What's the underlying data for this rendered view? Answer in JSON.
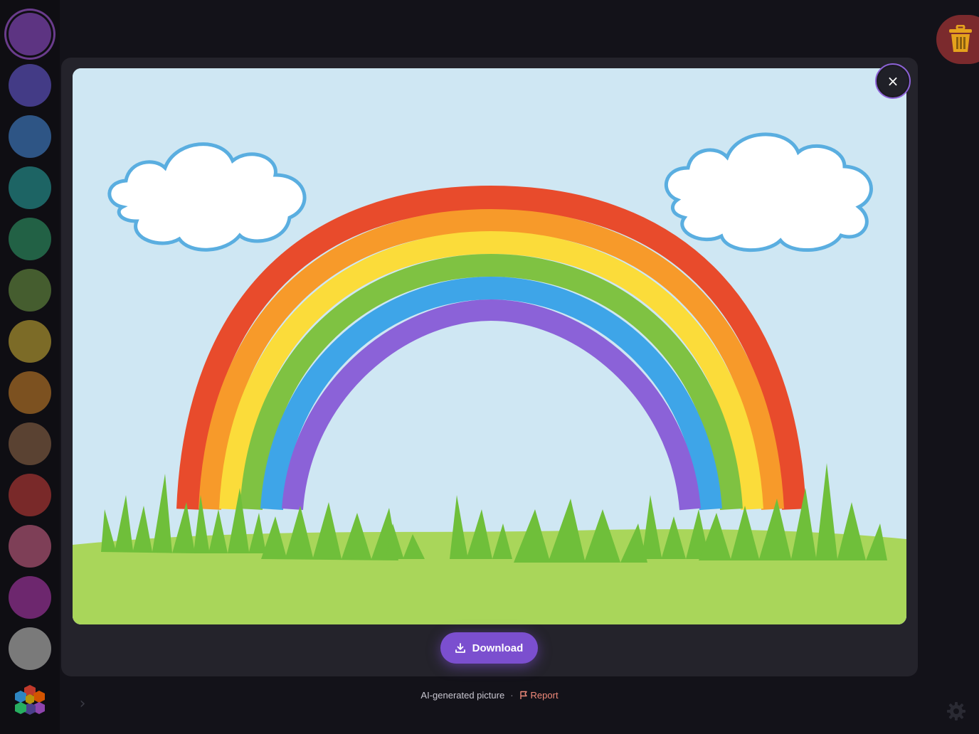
{
  "sidebar": {
    "swatches": [
      {
        "name": "swatch-purple",
        "color": "#5d3482",
        "selected": true
      },
      {
        "name": "swatch-indigo",
        "color": "#433b86"
      },
      {
        "name": "swatch-blue",
        "color": "#2e5585"
      },
      {
        "name": "swatch-teal",
        "color": "#1d6464"
      },
      {
        "name": "swatch-green",
        "color": "#226145"
      },
      {
        "name": "swatch-olive",
        "color": "#455d2f"
      },
      {
        "name": "swatch-mustard",
        "color": "#7c6b27"
      },
      {
        "name": "swatch-orange",
        "color": "#7c5120"
      },
      {
        "name": "swatch-brown",
        "color": "#5a4232"
      },
      {
        "name": "swatch-red",
        "color": "#792929"
      },
      {
        "name": "swatch-pink",
        "color": "#7e3f57"
      },
      {
        "name": "swatch-magenta",
        "color": "#6d276e"
      },
      {
        "name": "swatch-gray",
        "color": "#7a7a7a"
      }
    ],
    "palette_icon": "hexagon-palette-icon",
    "expand_icon": "chevron-right-icon"
  },
  "toolbar": {
    "trash_icon": "trash-icon",
    "trash_color": "#7b2a2d",
    "settings_icon": "gear-icon"
  },
  "modal": {
    "close_label": "×",
    "download_label": "Download",
    "download_icon": "download-icon",
    "accent": "#7b4fcf"
  },
  "footer": {
    "ai_label": "AI-generated picture",
    "separator": "·",
    "report_label": "Report",
    "report_color": "#f08a7a"
  }
}
